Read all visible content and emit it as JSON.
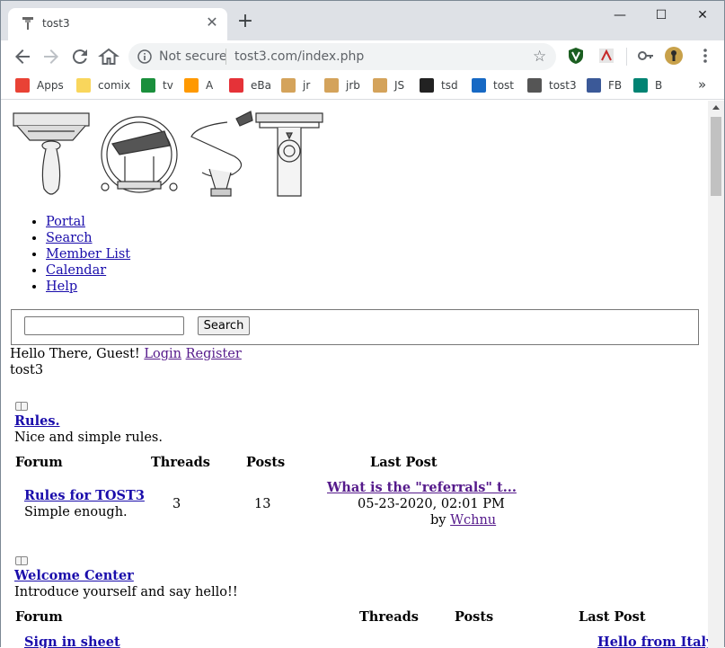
{
  "browser": {
    "tab_title": "tost3",
    "new_tab_symbol": "+",
    "window_controls": {
      "minimize": "—",
      "maximize": "☐",
      "close": "✕"
    },
    "omnibox": {
      "security_text": "Not secure",
      "url": "tost3.com/index.php"
    },
    "bookmarks": [
      {
        "label": "Apps",
        "icon": "apps-grid-icon",
        "color": "#e94235"
      },
      {
        "label": "comix",
        "icon": "folder-icon",
        "color": "#f9d65c"
      },
      {
        "label": "tv",
        "icon": "z-icon",
        "color": "#1a8f3c"
      },
      {
        "label": "A",
        "icon": "amazon-icon",
        "color": "#ff9900"
      },
      {
        "label": "eBa",
        "icon": "ebay-bag-icon",
        "color": "#e53238"
      },
      {
        "label": "jr",
        "icon": "page-icon",
        "color": "#d4a35b"
      },
      {
        "label": "jrb",
        "icon": "page-icon",
        "color": "#d4a35b"
      },
      {
        "label": "JS",
        "icon": "page-icon",
        "color": "#d4a35b"
      },
      {
        "label": "tsd",
        "icon": "s-icon",
        "color": "#222222"
      },
      {
        "label": "tost",
        "icon": "pb-icon",
        "color": "#1769c4"
      },
      {
        "label": "tost3",
        "icon": "tost-icon",
        "color": "#555555"
      },
      {
        "label": "FB",
        "icon": "facebook-icon",
        "color": "#3b5998"
      },
      {
        "label": "B",
        "icon": "bing-icon",
        "color": "#008373"
      }
    ],
    "bookmarks_overflow": "»"
  },
  "page": {
    "nav": [
      "Portal",
      "Search",
      "Member List",
      "Calendar",
      "Help"
    ],
    "search": {
      "value": "",
      "button_label": "Search"
    },
    "welcome": {
      "greeting": "Hello There, Guest!",
      "login": "Login",
      "register": "Register"
    },
    "board_name": "tost3",
    "categories": [
      {
        "title": "Rules.",
        "description": "Nice and simple rules.",
        "headers": {
          "forum": "Forum",
          "threads": "Threads",
          "posts": "Posts",
          "last_post": "Last Post"
        },
        "forums": [
          {
            "name": "Rules for TOST3",
            "description": "Simple enough.",
            "threads": "3",
            "posts": "13",
            "last_post_title": "What is the \"referrals\" t...",
            "last_post_date": "05-23-2020, 02:01 PM",
            "last_post_by_prefix": "by",
            "last_post_author": "Wchnu"
          }
        ]
      },
      {
        "title": "Welcome Center",
        "description": "Introduce yourself and say hello!!",
        "headers": {
          "forum": "Forum",
          "threads": "Threads",
          "posts": "Posts",
          "last_post": "Last Post"
        },
        "forums": [
          {
            "name": "Sign in sheet",
            "last_post_title": "Hello from Italy"
          }
        ]
      }
    ]
  }
}
